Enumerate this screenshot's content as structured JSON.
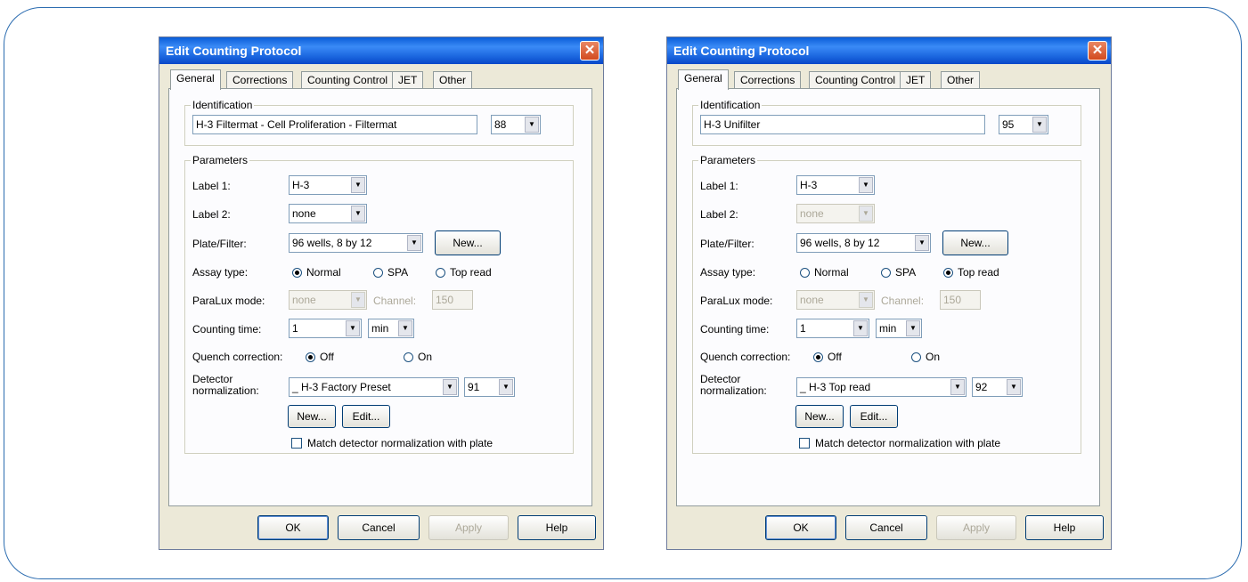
{
  "dialogs": [
    {
      "title": "Edit Counting Protocol",
      "close": "✕",
      "tabs": [
        "General",
        "Corrections",
        "Counting Control",
        "JET",
        "Other"
      ],
      "identification_label": "Identification",
      "protocol_name": "H-3 Filtermat - Cell Proliferation - Filtermat",
      "protocol_number": "88",
      "parameters_label": "Parameters",
      "label1_label": "Label 1:",
      "label1_value": "H-3",
      "label2_label": "Label 2:",
      "label2_value": "none",
      "plate_label": "Plate/Filter:",
      "plate_value": "96 wells, 8 by 12",
      "new_label": "New...",
      "assay_label": "Assay type:",
      "assay_normal": "Normal",
      "assay_spa": "SPA",
      "assay_top": "Top read",
      "assay_selected": "Normal",
      "paralux_label": "ParaLux mode:",
      "paralux_value": "none",
      "channel_label": "Channel:",
      "channel_value": "150",
      "counting_time_label": "Counting time:",
      "counting_time_value": "1",
      "counting_time_unit": "min",
      "quench_label": "Quench correction:",
      "quench_off": "Off",
      "quench_on": "On",
      "quench_selected": "Off",
      "detector_label_line1": "Detector",
      "detector_label_line2": "normalization:",
      "detector_value": "_ H-3 Factory Preset",
      "detector_number": "91",
      "det_new": "New...",
      "det_edit": "Edit...",
      "match_label": "Match detector normalization with plate",
      "ok": "OK",
      "cancel": "Cancel",
      "apply": "Apply",
      "help": "Help"
    },
    {
      "title": "Edit Counting Protocol",
      "close": "✕",
      "tabs": [
        "General",
        "Corrections",
        "Counting Control",
        "JET",
        "Other"
      ],
      "identification_label": "Identification",
      "protocol_name": "H-3 Unifilter",
      "protocol_number": "95",
      "parameters_label": "Parameters",
      "label1_label": "Label 1:",
      "label1_value": "H-3",
      "label2_label": "Label 2:",
      "label2_value": "none",
      "plate_label": "Plate/Filter:",
      "plate_value": "96 wells, 8 by 12",
      "new_label": "New...",
      "assay_label": "Assay type:",
      "assay_normal": "Normal",
      "assay_spa": "SPA",
      "assay_top": "Top read",
      "assay_selected": "Top read",
      "paralux_label": "ParaLux mode:",
      "paralux_value": "none",
      "channel_label": "Channel:",
      "channel_value": "150",
      "counting_time_label": "Counting time:",
      "counting_time_value": "1",
      "counting_time_unit": "min",
      "quench_label": "Quench correction:",
      "quench_off": "Off",
      "quench_on": "On",
      "quench_selected": "Off",
      "detector_label_line1": "Detector",
      "detector_label_line2": "normalization:",
      "detector_value": "_ H-3 Top read",
      "detector_number": "92",
      "det_new": "New...",
      "det_edit": "Edit...",
      "match_label": "Match detector normalization with plate",
      "ok": "OK",
      "cancel": "Cancel",
      "apply": "Apply",
      "help": "Help"
    }
  ]
}
